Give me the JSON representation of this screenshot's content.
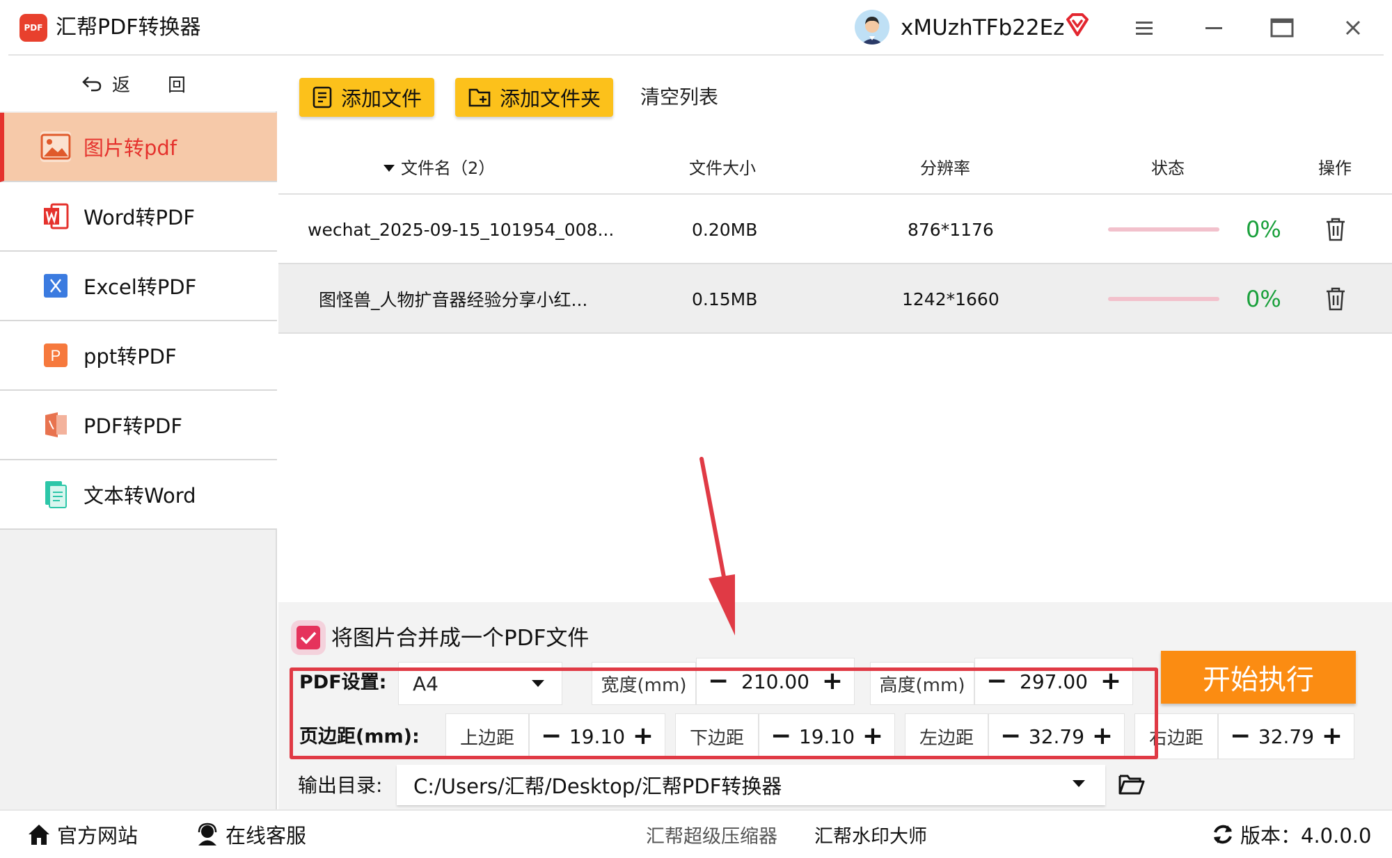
{
  "app": {
    "logo_text": "PDF",
    "title": "汇帮PDF转换器",
    "username": "xMUzhTFb22Ez"
  },
  "sidebar": {
    "back_label": "返　回",
    "items": [
      {
        "label": "图片转pdf",
        "icon": "image-icon"
      },
      {
        "label": "Word转PDF",
        "icon": "word-icon"
      },
      {
        "label": "Excel转PDF",
        "icon": "excel-icon"
      },
      {
        "label": "ppt转PDF",
        "icon": "ppt-icon"
      },
      {
        "label": "PDF转PDF",
        "icon": "pdf-icon"
      },
      {
        "label": "文本转Word",
        "icon": "text-icon"
      }
    ]
  },
  "toolbar": {
    "add_file": "添加文件",
    "add_folder": "添加文件夹",
    "clear_list": "清空列表"
  },
  "table": {
    "headers": {
      "filename": "文件名（2）",
      "size": "文件大小",
      "resolution": "分辨率",
      "status": "状态",
      "action": "操作"
    },
    "rows": [
      {
        "name": "wechat_2025-09-15_101954_008...",
        "size": "0.20MB",
        "resolution": "876*1176",
        "progress": 0,
        "percent": "0%"
      },
      {
        "name": "图怪兽_人物扩音器经验分享小红...",
        "size": "0.15MB",
        "resolution": "1242*1660",
        "progress": 0,
        "percent": "0%"
      }
    ]
  },
  "settings": {
    "merge_label": "将图片合并成一个PDF文件",
    "merge_checked": true,
    "pdf_settings_label": "PDF设置:",
    "page_size": "A4",
    "width_label": "宽度(mm)",
    "width_value": "210.00",
    "height_label": "高度(mm)",
    "height_value": "297.00",
    "margin_label": "页边距(mm):",
    "top_label": "上边距",
    "top_value": "19.10",
    "bottom_label": "下边距",
    "bottom_value": "19.10",
    "left_label": "左边距",
    "left_value": "32.79",
    "right_label": "右边距",
    "right_value": "32.79",
    "start_button": "开始执行",
    "output_label": "输出目录:",
    "output_path": "C:/Users/汇帮/Desktop/汇帮PDF转换器"
  },
  "footer": {
    "website": "官方网站",
    "support": "在线客服",
    "compressor": "汇帮超级压缩器",
    "watermark": "汇帮水印大师",
    "version": "版本：4.0.0.0"
  },
  "colors": {
    "accent_yellow": "#fcc11b",
    "accent_orange": "#fb8c12",
    "active_red": "#e5322d",
    "active_bg": "#f6c9a9",
    "percent_green": "#19a03b",
    "highlight_red": "#e03a45"
  }
}
